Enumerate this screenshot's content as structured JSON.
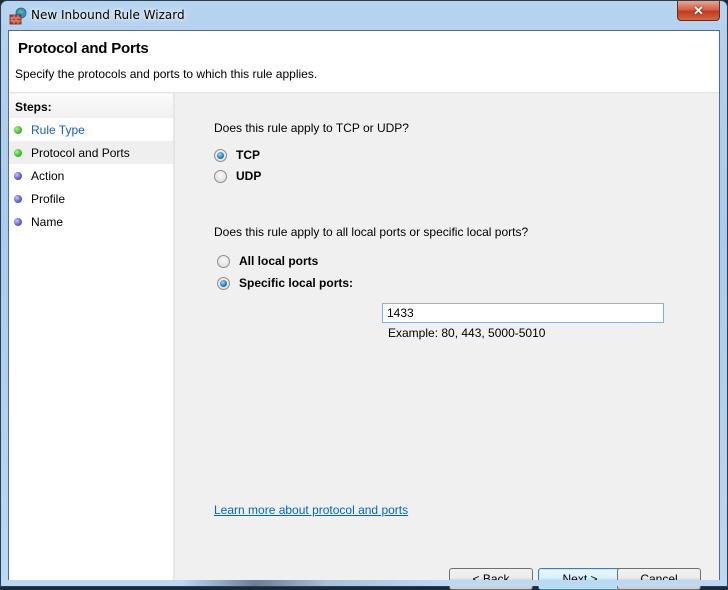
{
  "window": {
    "title": "New Inbound Rule Wizard",
    "close_glyph": "✕"
  },
  "header": {
    "title": "Protocol and Ports",
    "subtitle": "Specify the protocols and ports to which this rule applies."
  },
  "steps": {
    "heading": "Steps:",
    "items": [
      {
        "label": "Rule Type",
        "state": "completed"
      },
      {
        "label": "Protocol and Ports",
        "state": "current"
      },
      {
        "label": "Action",
        "state": "pending"
      },
      {
        "label": "Profile",
        "state": "pending"
      },
      {
        "label": "Name",
        "state": "pending"
      }
    ]
  },
  "protocol": {
    "question": "Does this rule apply to TCP or UDP?",
    "options": [
      {
        "label": "TCP",
        "selected": true
      },
      {
        "label": "UDP",
        "selected": false
      }
    ]
  },
  "ports": {
    "question": "Does this rule apply to all local ports or specific local ports?",
    "options": [
      {
        "label": "All local ports",
        "selected": false
      },
      {
        "label": "Specific local ports:",
        "selected": true
      }
    ],
    "input_value": "1433",
    "example": "Example: 80, 443, 5000-5010"
  },
  "learn_more_link": "Learn more about protocol and ports",
  "buttons": {
    "back": "< Back",
    "next": "Next >",
    "cancel": "Cancel"
  },
  "colors": {
    "link": "#0066cc",
    "step_completed_dot": "#4cc23a",
    "step_pending_dot": "#6a68d0"
  }
}
